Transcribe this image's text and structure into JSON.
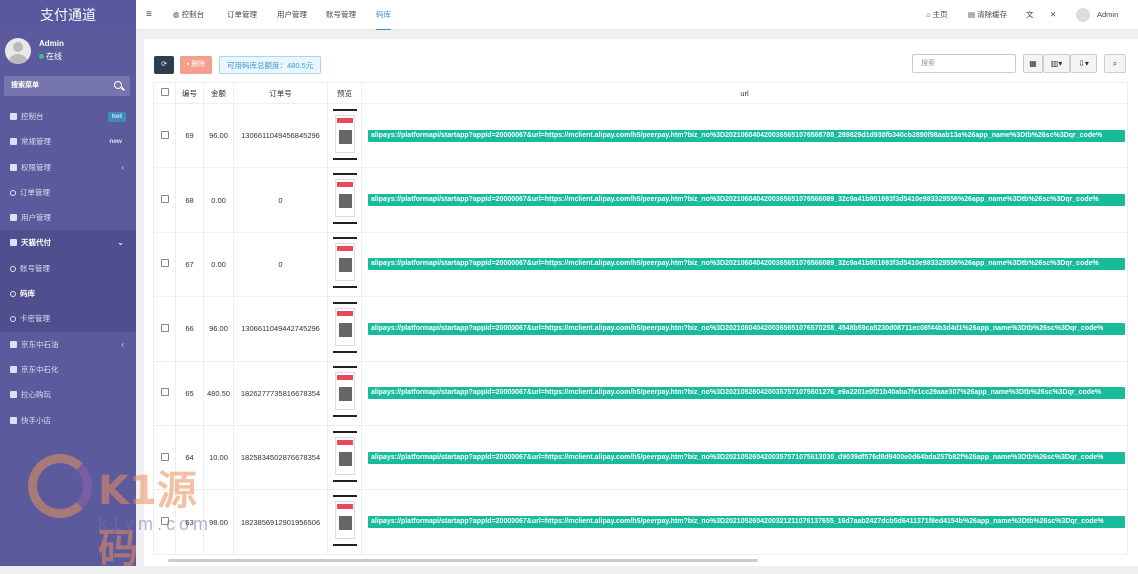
{
  "app": {
    "title": "支付通道"
  },
  "user": {
    "name": "Admin",
    "status": "在线"
  },
  "search": {
    "placeholder": "搜索菜单"
  },
  "menu": [
    {
      "label": "控制台",
      "badge": "hot"
    },
    {
      "label": "常规管理",
      "badge": "new"
    },
    {
      "label": "权限管理",
      "chevron": "‹"
    },
    {
      "label": "订单管理"
    },
    {
      "label": "用户管理"
    },
    {
      "label": "天猫代付",
      "chevron": "⌄"
    },
    {
      "label": "账号管理"
    },
    {
      "label": "码库"
    },
    {
      "label": "卡密管理"
    },
    {
      "label": "京东中石油",
      "chevron": "‹"
    },
    {
      "label": "京东中石化"
    },
    {
      "label": "拉心购玩"
    },
    {
      "label": "快手小店"
    }
  ],
  "topnav": {
    "menu_icon": "≡",
    "tabs": [
      "控制台",
      "订单管理",
      "用户管理",
      "账号管理",
      "码库"
    ],
    "home": "主页",
    "clear_cache": "清除缓存",
    "admin": "Admin"
  },
  "toolbar": {
    "delete": "删除",
    "quota": "可用码库总额度：480.5元",
    "search_placeholder": "搜索"
  },
  "table": {
    "headers": [
      "编号",
      "金额",
      "订单号",
      "预览",
      "url"
    ],
    "rows": [
      {
        "id": "69",
        "amount": "96.00",
        "order": "1306611049456845296",
        "url": "alipays://platformapi/startapp?appId=20000067&url=https://mclient.alipay.com/h5/peerpay.htm?biz_no%3D2021060404200365651076568788_289829d1d938fb340cb2890f98aab13a%26app_name%3Dtb%26sc%3Dqr_code%"
      },
      {
        "id": "68",
        "amount": "0.00",
        "order": "0",
        "url": "alipays://platformapi/startapp?appId=20000067&url=https://mclient.alipay.com/h5/peerpay.htm?biz_no%3D2021060404200365651076566089_32c9a41b901693f3d5410e983329556%26app_name%3Dtb%26sc%3Dqr_code%"
      },
      {
        "id": "67",
        "amount": "0.00",
        "order": "0",
        "url": "alipays://platformapi/startapp?appId=20000067&url=https://mclient.alipay.com/h5/peerpay.htm?biz_no%3D2021060404200365651076566089_32c9a41b901693f3d5410e983329556%26app_name%3Dtb%26sc%3Dqr_code%"
      },
      {
        "id": "66",
        "amount": "96.00",
        "order": "1306611049442745296",
        "url": "alipays://platformapi/startapp?appId=20000067&url=https://mclient.alipay.com/h5/peerpay.htm?biz_no%3D2021060404200365651076570258_4548b59ca5230d08711ec08f44b3d4d1%26app_name%3Dtb%26sc%3Dqr_code%"
      },
      {
        "id": "65",
        "amount": "480.50",
        "order": "1826277735816678354",
        "url": "alipays://platformapi/startapp?appId=20000067&url=https://mclient.alipay.com/h5/peerpay.htm?biz_no%3D2021052604200357571075601276_e9a2201e0f21b40aba7fe1cc29aae307%26app_name%3Dtb%26sc%3Dqr_code%"
      },
      {
        "id": "64",
        "amount": "10.00",
        "order": "1825834502876678354",
        "url": "alipays://platformapi/startapp?appId=20000067&url=https://mclient.alipay.com/h5/peerpay.htm?biz_no%3D2021052604200357571075613030_d9039df576d8d9400e0d64bda257b82f%26app_name%3Dtb%26sc%3Dqr_code%"
      },
      {
        "id": "63",
        "amount": "98.00",
        "order": "1823856912901956506",
        "url": "alipays://platformapi/startapp?appId=20000067&url=https://mclient.alipay.com/h5/peerpay.htm?biz_no%3D2021052604200321211076137655_16d7aab2427dcb5d6411371f8ed4154b%26app_name%3Dtb%26sc%3Dqr_code%"
      }
    ]
  },
  "watermark": {
    "brand": "K1源码",
    "site": "k1ym.com"
  },
  "colors": {
    "sidebar": "#5b5a9d",
    "accent": "#3c8dbc",
    "url_badge": "#18bc9c",
    "delete": "#f59e8f"
  }
}
